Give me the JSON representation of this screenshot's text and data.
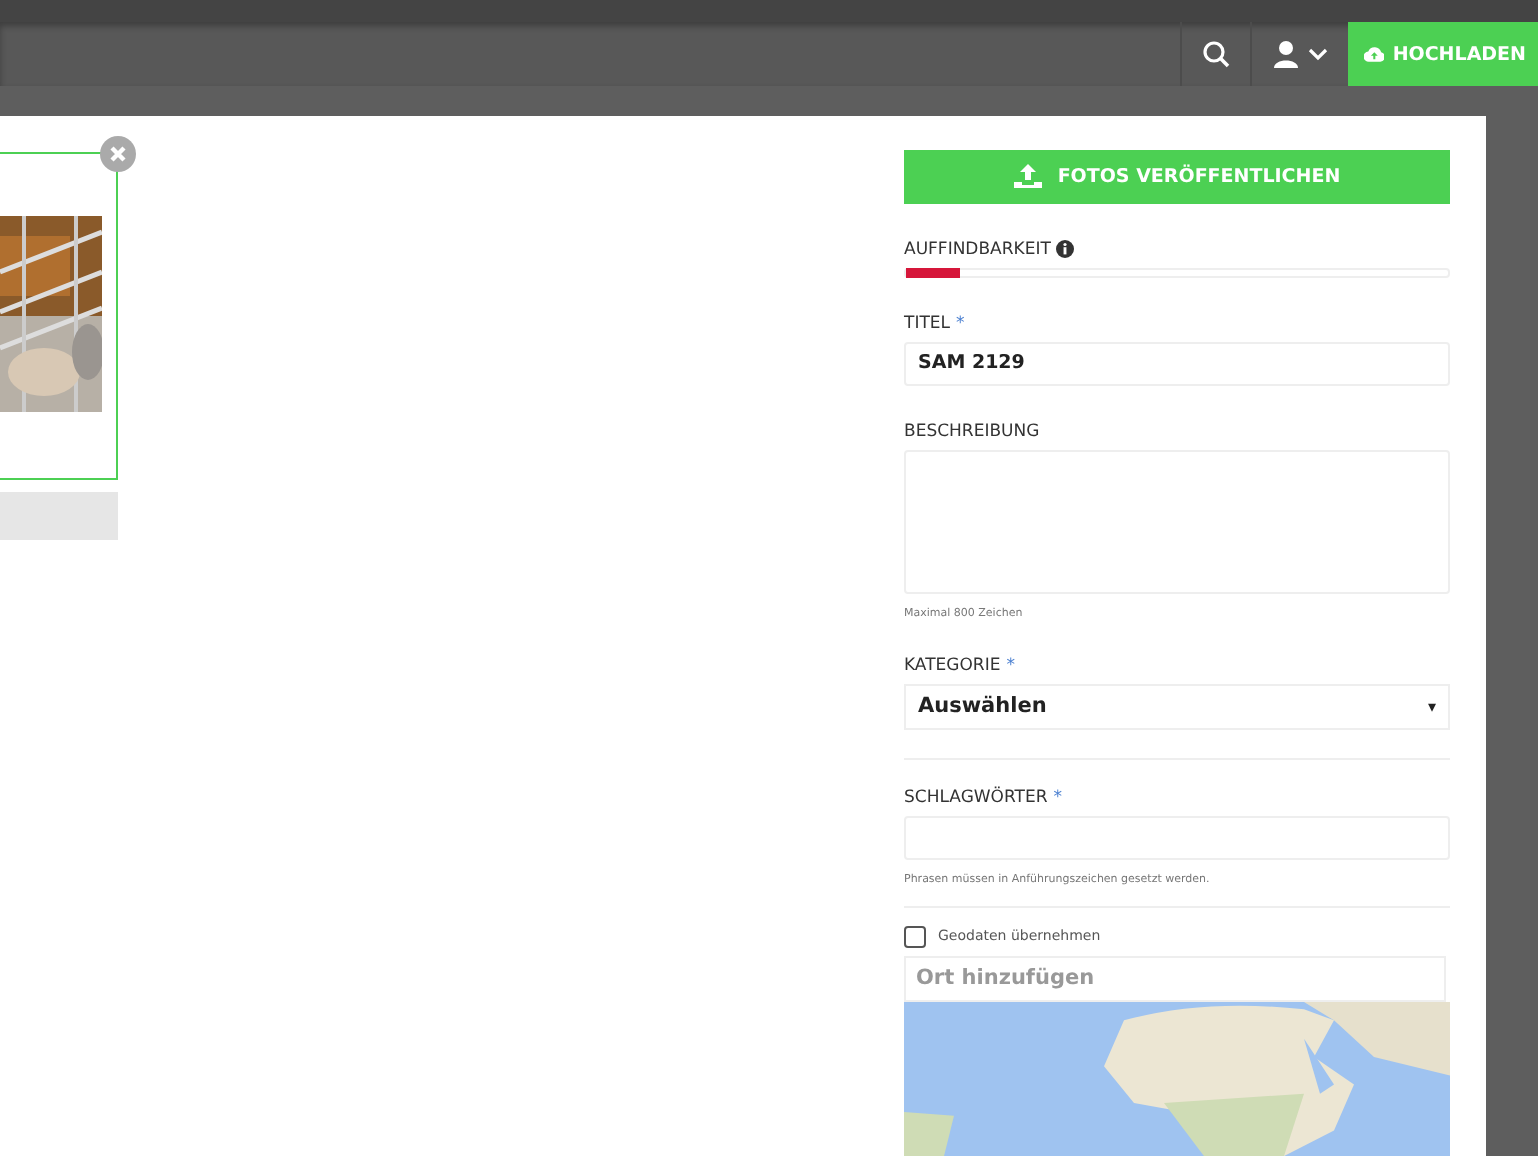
{
  "header": {
    "upload_button": "HOCHLADEN"
  },
  "photo_card": {
    "selected": true
  },
  "sidebar": {
    "publish_button": "FOTOS VERÖFFENTLICHEN",
    "findability": {
      "label": "AUFFINDBARKEIT",
      "level": 0.1
    },
    "fields": [
      {
        "kind": "input",
        "label": "TITEL",
        "required_mark": "*",
        "value": "SAM 2129"
      },
      {
        "kind": "textarea",
        "label": "BESCHREIBUNG",
        "hint": "Maximal 800 Zeichen"
      },
      {
        "kind": "select",
        "label": "KATEGORIE",
        "required_mark": "*",
        "value": "Auswählen",
        "caret": "▾"
      },
      {
        "kind": "input",
        "label": "SCHLAGWÖRTER",
        "required_mark": "*",
        "hint": "Phrasen müssen in Anführungszeichen gesetzt werden."
      }
    ],
    "geodata": {
      "label": "Geodaten übernehmen",
      "checked": false
    },
    "location": {
      "placeholder": "Ort hinzufügen"
    }
  }
}
